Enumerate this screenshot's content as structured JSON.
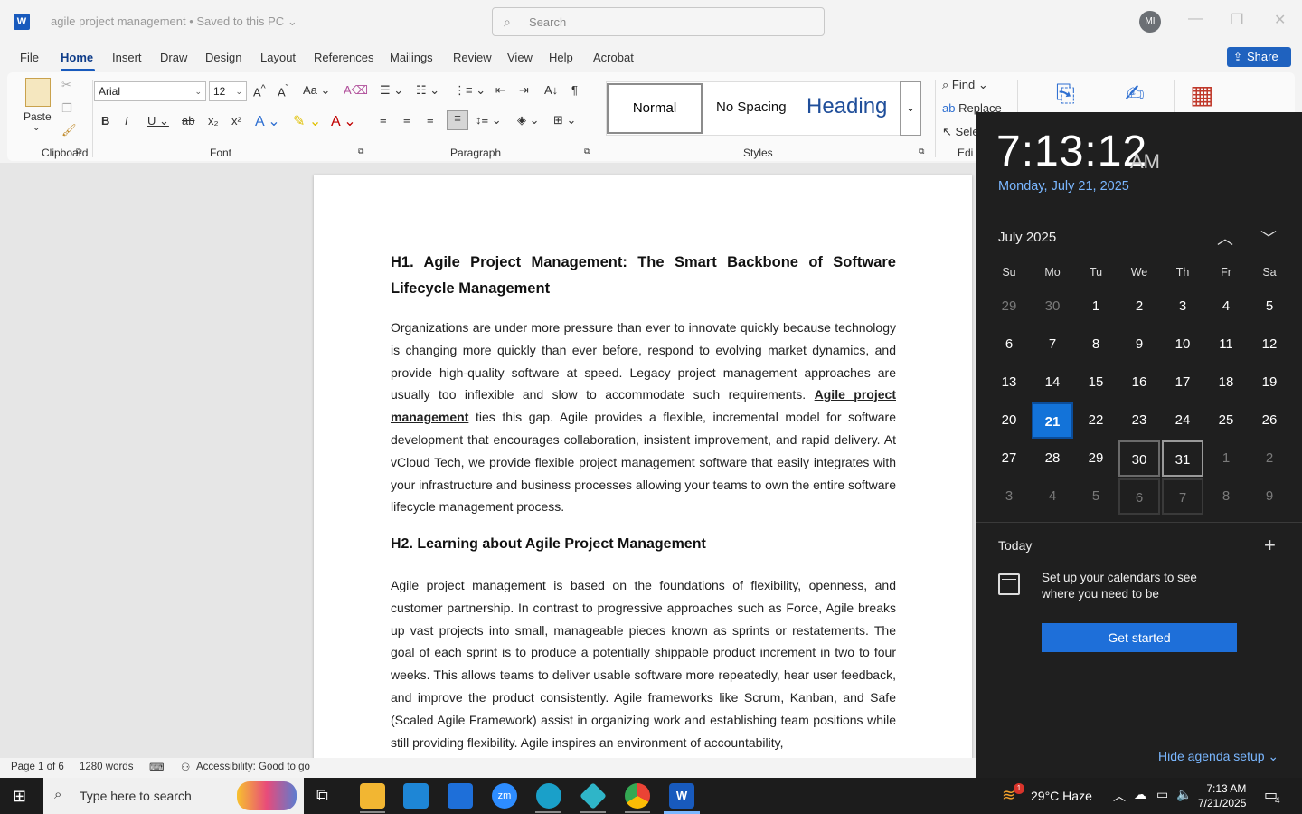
{
  "titlebar": {
    "app_logo": "W",
    "doc_title": "agile project management • Saved to this PC",
    "search_placeholder": "Search",
    "avatar_initials": "MI",
    "share_label": "Share"
  },
  "menu": [
    "File",
    "Home",
    "Insert",
    "Draw",
    "Design",
    "Layout",
    "References",
    "Mailings",
    "Review",
    "View",
    "Help",
    "Acrobat"
  ],
  "ribbon": {
    "paste_label": "Paste",
    "font_name": "Arial",
    "font_size": "12",
    "styles": [
      "Normal",
      "No Spacing",
      "Heading"
    ],
    "find_label": "Find",
    "replace_label": "Replace",
    "select_label": "Sele",
    "edit_label": "Edi",
    "groups": [
      "Clipboard",
      "Font",
      "Paragraph",
      "Styles"
    ]
  },
  "document": {
    "h1": "H1. Agile Project Management: The Smart Backbone of Software Lifecycle Management",
    "p1_a": "Organizations are under more pressure than ever to innovate quickly because technology is changing more quickly than ever before, respond to evolving market dynamics, and provide high-quality software at speed. Legacy project management approaches are usually too inflexible and slow to accommodate such requirements. ",
    "p1_link": "Agile project management",
    "p1_b": " ties this gap. Agile provides a flexible, incremental model for software development that encourages collaboration, insistent improvement, and rapid delivery. At vCloud Tech, we provide flexible project management software that easily integrates with your infrastructure and business processes allowing your teams to own the entire software lifecycle management process.",
    "h2": "H2. Learning about Agile Project Management",
    "p2": "Agile project management is based on the foundations of flexibility, openness, and customer partnership. In contrast to progressive approaches such as Force, Agile breaks up vast projects into small, manageable pieces known as sprints or restatements. The goal of each sprint is to produce a potentially shippable product increment in two to four weeks. This allows teams to deliver usable software more repeatedly, hear user feedback, and improve the product consistently. Agile frameworks like Scrum, Kanban, and Safe (Scaled Agile Framework) assist in organizing work and establishing team positions while still providing flexibility. Agile inspires an environment of accountability,"
  },
  "statusbar": {
    "page": "Page 1 of 6",
    "words": "1280 words",
    "accessibility": "Accessibility: Good to go"
  },
  "flyout": {
    "time": "7:13:12",
    "ampm": "AM",
    "date": "Monday, July 21, 2025",
    "month": "July 2025",
    "dow": [
      "Su",
      "Mo",
      "Tu",
      "We",
      "Th",
      "Fr",
      "Sa"
    ],
    "weeks": [
      [
        "29",
        "30",
        "1",
        "2",
        "3",
        "4",
        "5"
      ],
      [
        "6",
        "7",
        "8",
        "9",
        "10",
        "11",
        "12"
      ],
      [
        "13",
        "14",
        "15",
        "16",
        "17",
        "18",
        "19"
      ],
      [
        "20",
        "21",
        "22",
        "23",
        "24",
        "25",
        "26"
      ],
      [
        "27",
        "28",
        "29",
        "30",
        "31",
        "1",
        "2"
      ],
      [
        "3",
        "4",
        "5",
        "6",
        "7",
        "8",
        "9"
      ]
    ],
    "today_label": "Today",
    "setup_text": "Set up your calendars to see where you need to be",
    "get_started": "Get started",
    "hide_agenda": "Hide agenda setup"
  },
  "taskbar": {
    "search_placeholder": "Type here to search",
    "weather": "29°C  Haze",
    "weather_badge": "1",
    "time": "7:13 AM",
    "date": "7/21/2025",
    "notif_count": "4"
  }
}
